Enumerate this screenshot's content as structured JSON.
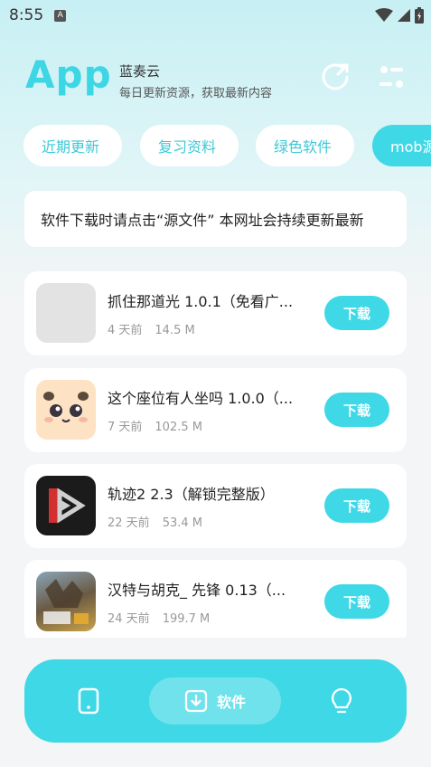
{
  "status_bar": {
    "time": "8:55",
    "notif_letter": "A"
  },
  "header": {
    "logo": "App",
    "name": "蓝奏云",
    "subtitle": "每日更新资源，获取最新内容",
    "icons": [
      "refresh-icon",
      "filter-icon"
    ]
  },
  "tabs": [
    {
      "label": "近期更新"
    },
    {
      "label": "复习资料"
    },
    {
      "label": "绿色软件"
    },
    {
      "label": "mob源"
    }
  ],
  "notice": {
    "text": "软件下载时请点击“源文件”     本网址会持续更新最新"
  },
  "apps": [
    {
      "title": "抓住那道光 1.0.1（免看广...",
      "age": "4 天前",
      "size": "14.5 M",
      "button": "下载"
    },
    {
      "title": "这个座位有人坐吗 1.0.0（...",
      "age": "7 天前",
      "size": "102.5 M",
      "button": "下载"
    },
    {
      "title": "轨迹2 2.3（解锁完整版）",
      "age": "22 天前",
      "size": "53.4 M",
      "button": "下载"
    },
    {
      "title": "汉特与胡克_ 先锋 0.13（...",
      "age": "24 天前",
      "size": "199.7 M",
      "button": "下载"
    }
  ],
  "bottom_nav": {
    "items": [
      {
        "icon": "phone-icon"
      },
      {
        "icon": "download-icon",
        "label": "软件",
        "active": true
      },
      {
        "icon": "lightbulb-icon"
      }
    ]
  },
  "colors": {
    "accent": "#3fd8e6",
    "logo": "#3cd6e4",
    "bg": "#f3f5f6"
  }
}
